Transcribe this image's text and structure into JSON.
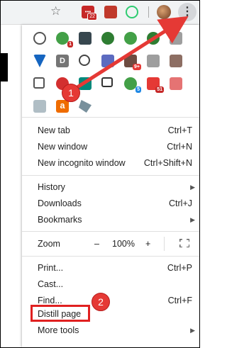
{
  "toolbar": {
    "star_icon": "star-outline",
    "ext1_badge": "22",
    "menu_glyph": "⋮"
  },
  "menu": {
    "items": [
      {
        "label": "New tab",
        "shortcut": "Ctrl+T"
      },
      {
        "label": "New window",
        "shortcut": "Ctrl+N"
      },
      {
        "label": "New incognito window",
        "shortcut": "Ctrl+Shift+N"
      },
      {
        "label": "History",
        "shortcut": ""
      },
      {
        "label": "Downloads",
        "shortcut": "Ctrl+J"
      },
      {
        "label": "Bookmarks",
        "shortcut": ""
      },
      {
        "label": "Print...",
        "shortcut": "Ctrl+P"
      },
      {
        "label": "Cast...",
        "shortcut": ""
      },
      {
        "label": "Find...",
        "shortcut": "Ctrl+F"
      },
      {
        "label": "Distill page",
        "shortcut": ""
      },
      {
        "label": "More tools",
        "shortcut": ""
      }
    ],
    "zoom": {
      "label": "Zoom",
      "minus": "–",
      "value": "100%",
      "plus": "+"
    }
  },
  "extensions": {
    "badges": {
      "r2c4": "3",
      "r3c6": "5",
      "r3c7": "51",
      "r2c7": "9+"
    },
    "icon_a": "a"
  },
  "annotations": {
    "step1": "1",
    "step2": "2",
    "color": "#e53935"
  }
}
